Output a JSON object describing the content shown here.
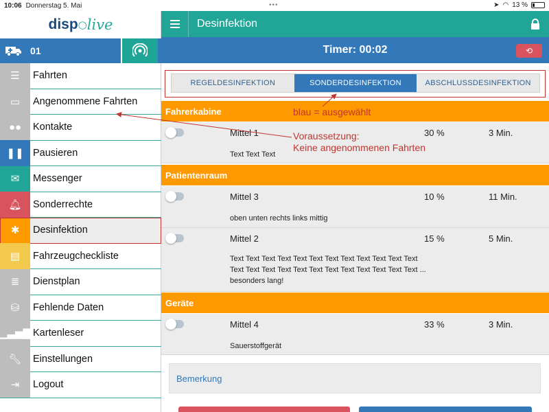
{
  "statusbar": {
    "time": "10:06",
    "date": "Donnerstag 5. Mai",
    "dots": "•••",
    "battery": "13 %"
  },
  "sidebar": {
    "logo_part1": "disp",
    "logo_part2": "live",
    "vehicle_number": "01",
    "items": [
      {
        "label": "Fahrten",
        "icon": "list-check-icon",
        "color": "#bdbdbd"
      },
      {
        "label": "Angenommene Fahrten",
        "icon": "id-card-icon",
        "color": "#bdbdbd"
      },
      {
        "label": "Kontakte",
        "icon": "users-icon",
        "color": "#bdbdbd"
      },
      {
        "label": "Pausieren",
        "icon": "pause-icon",
        "color": "#3378b8"
      },
      {
        "label": "Messenger",
        "icon": "envelope-icon",
        "color": "#21a597"
      },
      {
        "label": "Sonderrechte",
        "icon": "bell-icon",
        "color": "#d9535f"
      },
      {
        "label": "Desinfektion",
        "icon": "bug-icon",
        "color": "#ff9900"
      },
      {
        "label": "Fahrzeugcheckliste",
        "icon": "book-icon",
        "color": "#f2c94c"
      },
      {
        "label": "Dienstplan",
        "icon": "list-icon",
        "color": "#bdbdbd"
      },
      {
        "label": "Fehlende Daten",
        "icon": "database-icon",
        "color": "#bdbdbd"
      },
      {
        "label": "Kartenleser",
        "icon": "signal-bars-icon",
        "color": "#bdbdbd"
      },
      {
        "label": "Einstellungen",
        "icon": "wrench-icon",
        "color": "#bdbdbd"
      },
      {
        "label": "Logout",
        "icon": "logout-icon",
        "color": "#bdbdbd"
      }
    ]
  },
  "header": {
    "title": "Desinfektion"
  },
  "timer": {
    "text": "Timer: 00:02"
  },
  "tabs": [
    {
      "label": "REGELDESINFEKTION",
      "active": false
    },
    {
      "label": "SONDERDESINFEKTION",
      "active": true
    },
    {
      "label": "ABSCHLUSSDESINFEKTION",
      "active": false
    }
  ],
  "sections": [
    {
      "title": "Fahrerkabine",
      "items": [
        {
          "name": "Mittel 1",
          "percent": "30 %",
          "duration": "3 Min.",
          "description": "Text Text Text"
        }
      ]
    },
    {
      "title": "Patientenraum",
      "items": [
        {
          "name": "Mittel 3",
          "percent": "10 %",
          "duration": "11 Min.",
          "description": "oben unten rechts links mittig"
        },
        {
          "name": "Mittel 2",
          "percent": "15 %",
          "duration": "5 Min.",
          "description": "Text Text Text Text Text Text Text Text Text Text Text Text Text Text Text Text Text Text Text Text Text Text Text Text ... besonders lang!"
        }
      ]
    },
    {
      "title": "Geräte",
      "items": [
        {
          "name": "Mittel 4",
          "percent": "33 %",
          "duration": "3 Min.",
          "description": "Sauerstoffgerät"
        }
      ]
    }
  ],
  "remark": {
    "label": "Bemerkung"
  },
  "annotations": {
    "selected_note": "blau = ausgewählt",
    "precondition_line1": "Voraussetzung:",
    "precondition_line2": "Keine angenommenen Fahrten"
  }
}
